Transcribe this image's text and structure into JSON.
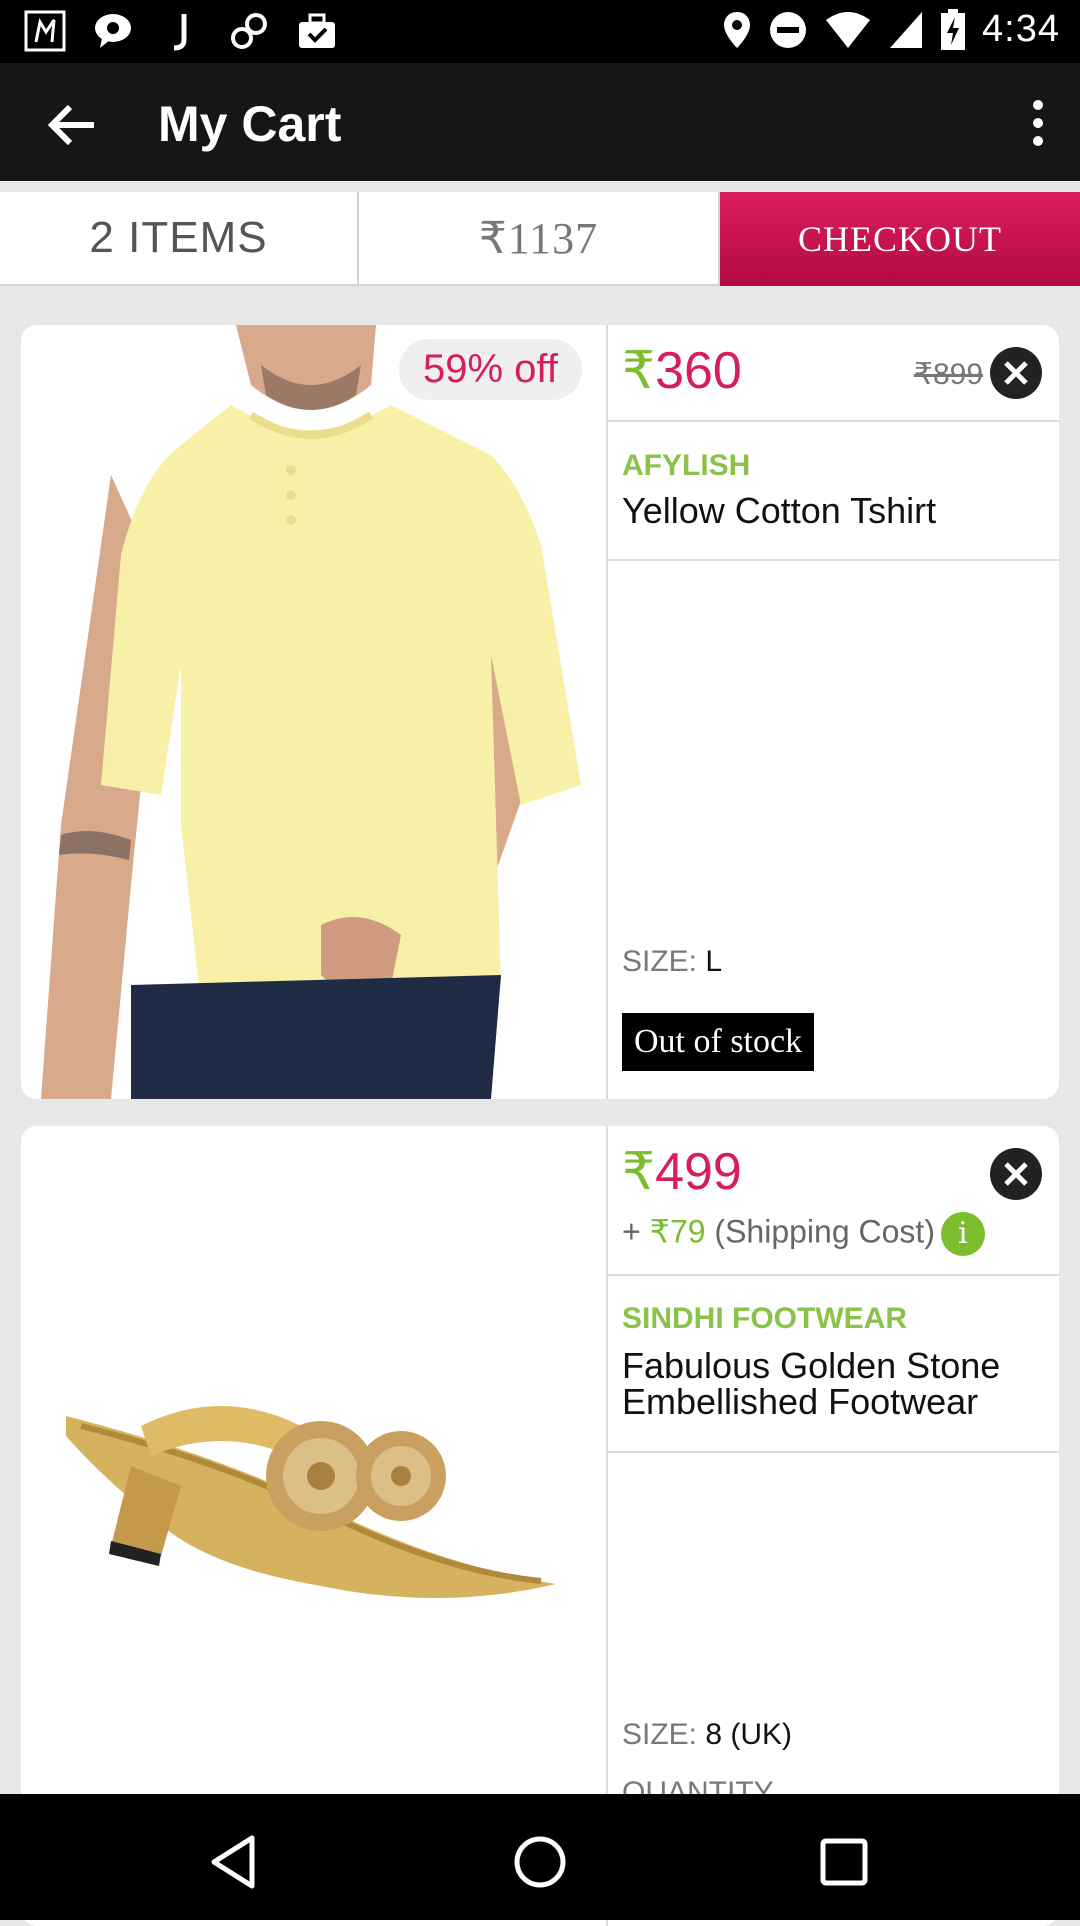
{
  "status_bar": {
    "time": "4:34",
    "left_icons": [
      "app-icon",
      "chat-icon",
      "j-icon",
      "link-icon",
      "briefcase-icon"
    ],
    "right_icons": [
      "location-icon",
      "dnd-icon",
      "wifi-icon",
      "signal-icon",
      "battery-charging-icon"
    ]
  },
  "appbar": {
    "title": "My Cart"
  },
  "summary": {
    "items_label": "2 ITEMS",
    "total": "₹1137",
    "checkout_label": "CHECKOUT"
  },
  "cart_items": [
    {
      "discount_badge": "59% off",
      "rupee": "₹",
      "price": "360",
      "mrp": "₹899",
      "brand": "AFYLISH",
      "name": "Yellow Cotton Tshirt",
      "size_label": "SIZE: ",
      "size_value": "L",
      "status": "Out of stock"
    },
    {
      "rupee": "₹",
      "price": "499",
      "shipping_prefix": "+ ",
      "shipping_amount": "₹79",
      "shipping_suffix": " (Shipping Cost)",
      "info_glyph": "i",
      "brand": "SINDHI FOOTWEAR",
      "name": "Fabulous Golden Stone Embellished Footwear",
      "size_label": "SIZE: ",
      "size_value": "8 (UK)",
      "quantity_label": "QUANTITY"
    }
  ],
  "colors": {
    "accent": "#d61e5a",
    "green": "#7bbd2d",
    "appbar": "#161616"
  }
}
